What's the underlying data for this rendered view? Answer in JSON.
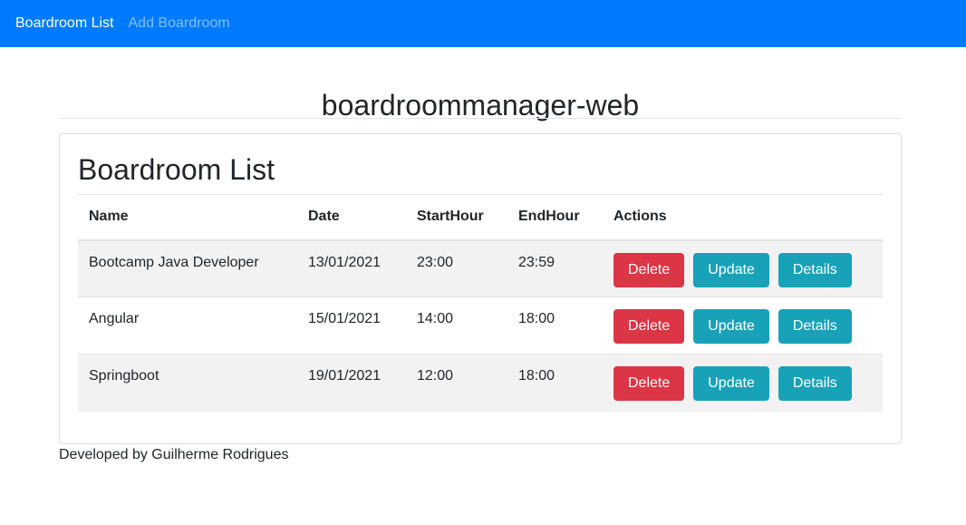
{
  "navbar": {
    "brand": "Boardroom List",
    "add_link": "Add Boardroom"
  },
  "page": {
    "app_title": "boardroommanager-web",
    "card_title": "Boardroom List",
    "footer": "Developed by Guilherme Rodrigues"
  },
  "table": {
    "headers": [
      "Name",
      "Date",
      "StartHour",
      "EndHour",
      "Actions"
    ],
    "rows": [
      {
        "name": "Bootcamp Java Developer",
        "date": "13/01/2021",
        "start": "23:00",
        "end": "23:59"
      },
      {
        "name": "Angular",
        "date": "15/01/2021",
        "start": "14:00",
        "end": "18:00"
      },
      {
        "name": "Springboot",
        "date": "19/01/2021",
        "start": "12:00",
        "end": "18:00"
      }
    ],
    "actions": {
      "delete": "Delete",
      "update": "Update",
      "details": "Details"
    }
  },
  "colors": {
    "navbar": "#007bff",
    "danger": "#dc3545",
    "info": "#17a2b8"
  }
}
